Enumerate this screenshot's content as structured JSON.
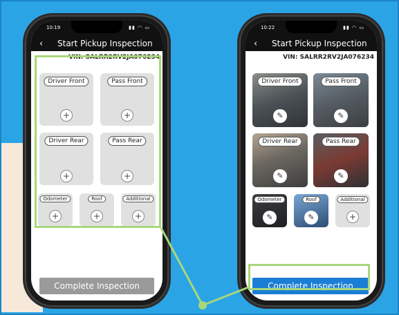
{
  "left_phone": {
    "status_time": "10:19",
    "title": "Start Pickup Inspection",
    "vin": "VIN: SALRR2RV2JA076234",
    "tiles": [
      "Driver Front",
      "Pass Front",
      "Driver Rear",
      "Pass Rear"
    ],
    "small_tiles": [
      "Odometer",
      "Roof",
      "Additional"
    ],
    "complete_label": "Complete Inspection"
  },
  "right_phone": {
    "status_time": "10:22",
    "title": "Start Pickup Inspection",
    "vin": "VIN: SALRR2RV2JA076234",
    "tiles": [
      "Driver Front",
      "Pass Front",
      "Driver Rear",
      "Pass Rear"
    ],
    "small_tiles": [
      "Odometer",
      "Roof",
      "Additional"
    ],
    "complete_label": "Complete Inspection"
  },
  "colors": {
    "background": "#2ba4e6",
    "highlight": "#a8d77a",
    "button_active": "#1a7ed4",
    "button_disabled": "#9a9a9a"
  },
  "icons": {
    "back": "‹",
    "plus": "+",
    "edit": "✎"
  }
}
